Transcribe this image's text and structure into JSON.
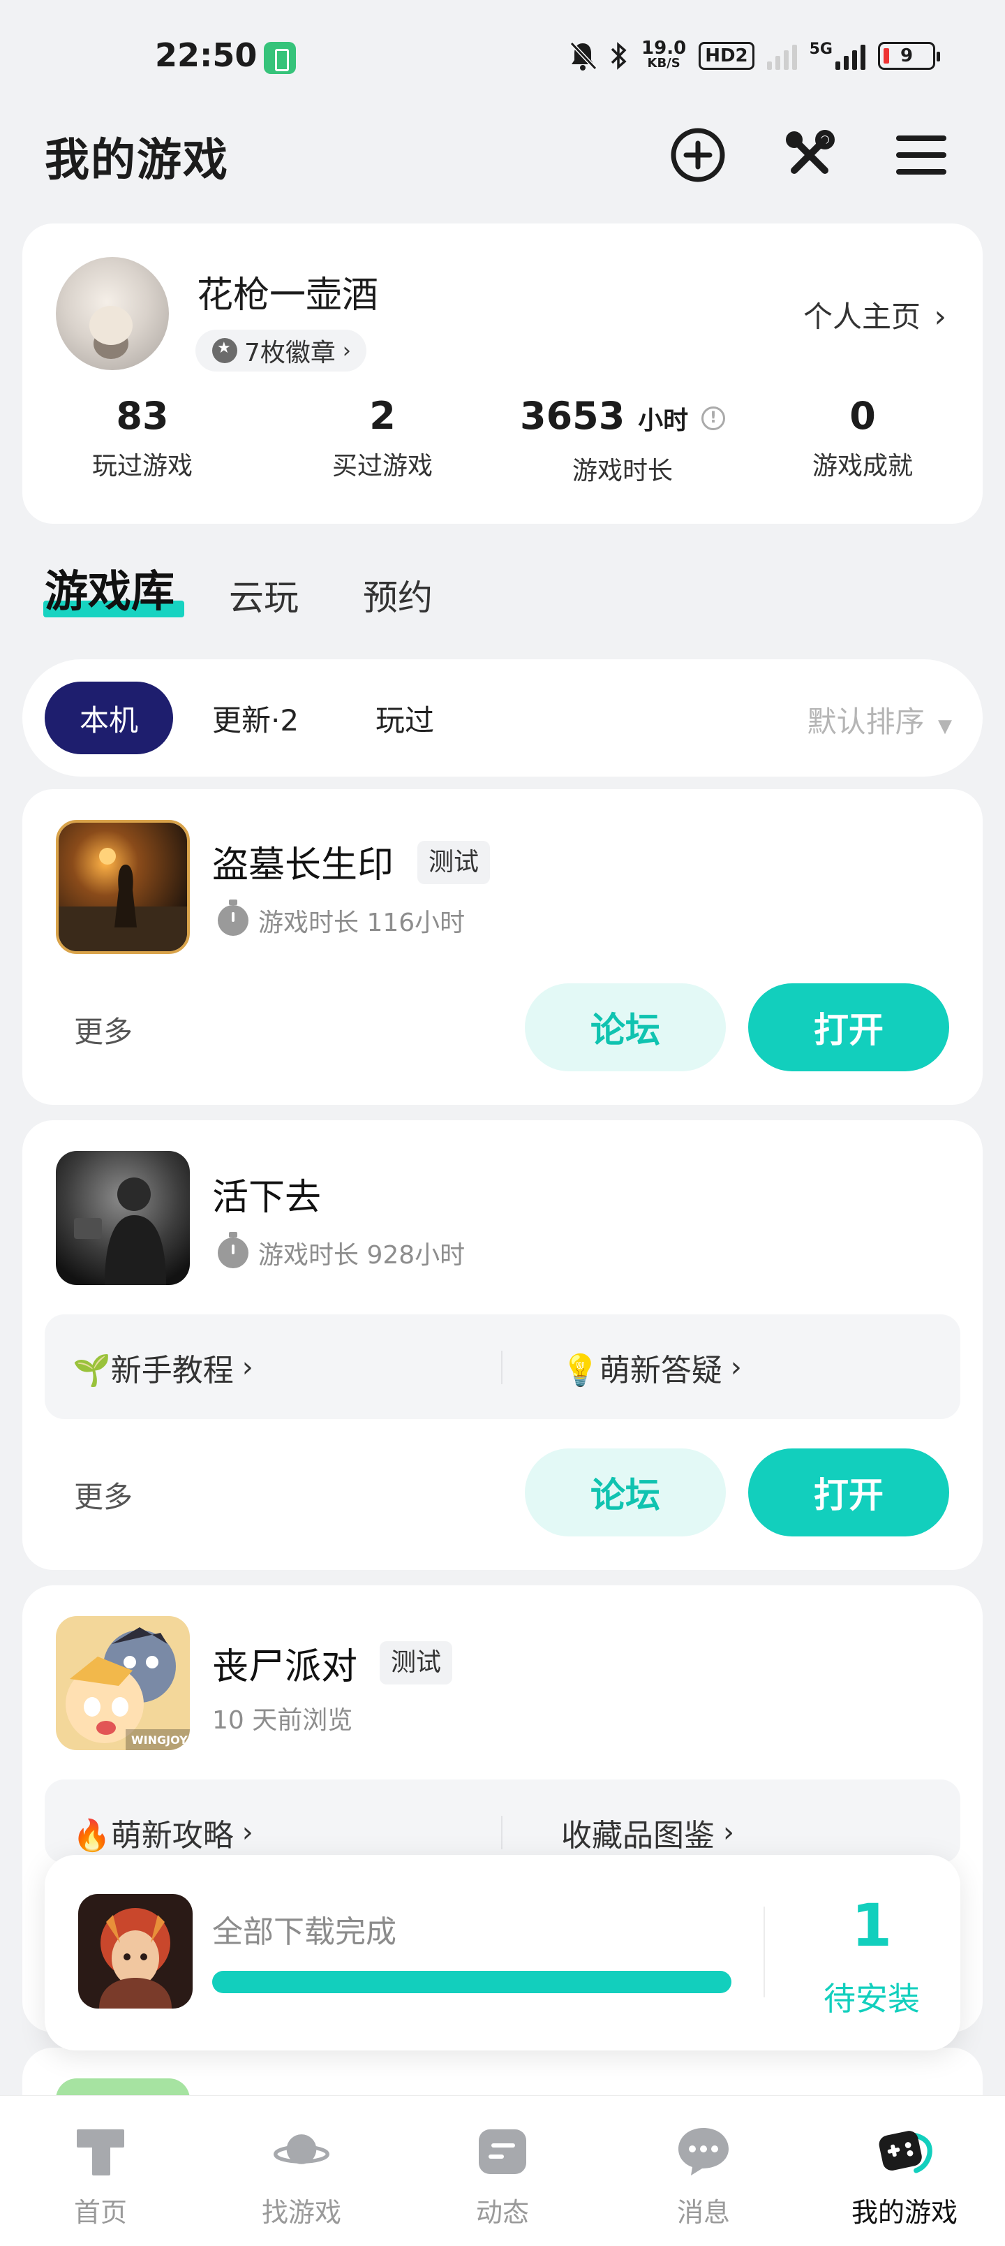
{
  "status_bar": {
    "time": "22:50",
    "net_speed_value": "19.0",
    "net_speed_unit": "KB/S",
    "hd_label": "HD2",
    "signal_label": "5G",
    "battery": "9"
  },
  "header": {
    "title": "我的游戏"
  },
  "profile": {
    "username": "花枪一壶酒",
    "badges": "7枚徽章",
    "homepage_link": "个人主页",
    "stats": [
      {
        "value": "83",
        "unit": "",
        "label": "玩过游戏"
      },
      {
        "value": "2",
        "unit": "",
        "label": "买过游戏"
      },
      {
        "value": "3653",
        "unit": "小时",
        "label": "游戏时长"
      },
      {
        "value": "0",
        "unit": "",
        "label": "游戏成就"
      }
    ]
  },
  "main_tabs": [
    "游戏库",
    "云玩",
    "预约"
  ],
  "filters": {
    "chips": [
      "本机",
      "更新·2",
      "玩过"
    ],
    "sort": "默认排序"
  },
  "games": [
    {
      "title": "盗墓长生印",
      "tag": "测试",
      "meta": "游戏时长 116小时",
      "more": "更多",
      "forum": "论坛",
      "open": "打开"
    },
    {
      "title": "活下去",
      "tag": "",
      "meta": "游戏时长 928小时",
      "quick": [
        "🌱新手教程",
        "💡萌新答疑"
      ],
      "more": "更多",
      "forum": "论坛",
      "open": "打开"
    },
    {
      "title": "丧尸派对",
      "tag": "测试",
      "meta": "10 天前浏览",
      "icon_caption": "WINGJOY",
      "quick": [
        "🔥萌新攻略",
        "收藏品图鉴"
      ]
    }
  ],
  "download": {
    "status": "全部下载完成",
    "progress": 1.0,
    "count": "1",
    "label": "待安装"
  },
  "bottom_nav": [
    {
      "label": "首页",
      "icon": "home-t-icon"
    },
    {
      "label": "找游戏",
      "icon": "planet-icon"
    },
    {
      "label": "动态",
      "icon": "feed-icon"
    },
    {
      "label": "消息",
      "icon": "chat-icon"
    },
    {
      "label": "我的游戏",
      "icon": "gamepad-icon",
      "active": true
    }
  ],
  "colors": {
    "accent": "#12cfbd",
    "active_chip": "#1e1e6e",
    "background": "#f1f2f4"
  }
}
